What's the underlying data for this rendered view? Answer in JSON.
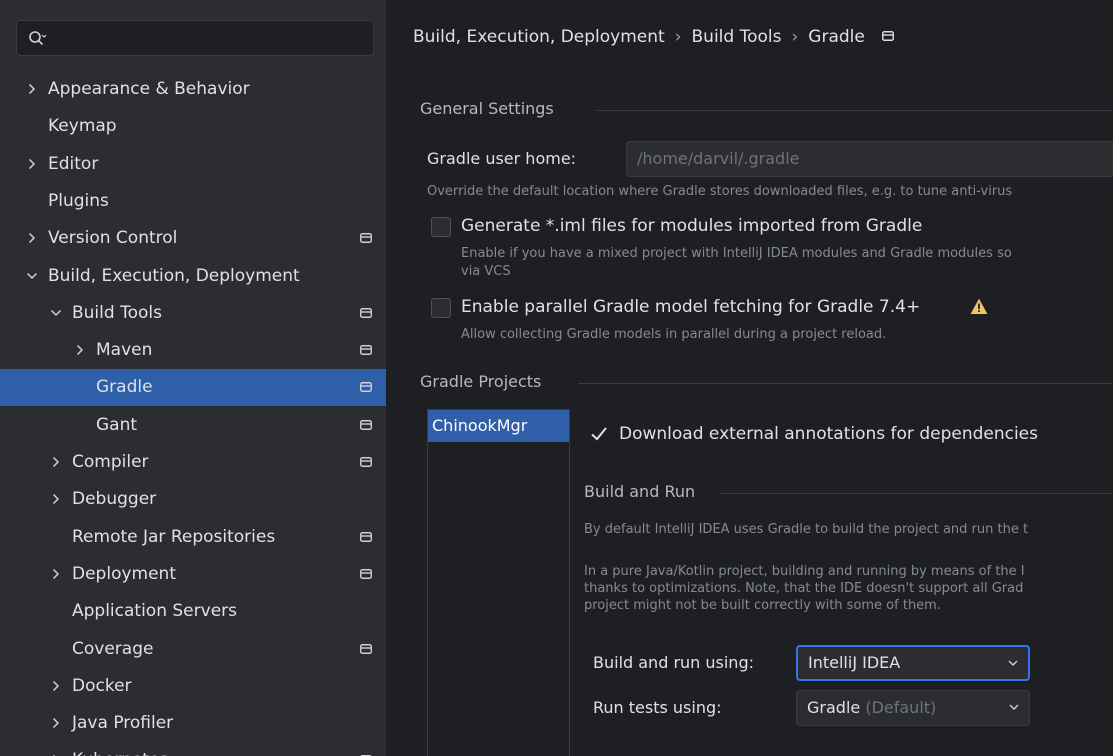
{
  "sidebar": {
    "search": {
      "value": ""
    },
    "items": [
      {
        "label": "Appearance & Behavior",
        "expandable": true,
        "expanded": false,
        "depth": 0,
        "project": false
      },
      {
        "label": "Keymap",
        "expandable": false,
        "depth": 0,
        "project": false
      },
      {
        "label": "Editor",
        "expandable": true,
        "expanded": false,
        "depth": 0,
        "project": false
      },
      {
        "label": "Plugins",
        "expandable": false,
        "depth": 0,
        "project": false
      },
      {
        "label": "Version Control",
        "expandable": true,
        "expanded": false,
        "depth": 0,
        "project": true
      },
      {
        "label": "Build, Execution, Deployment",
        "expandable": true,
        "expanded": true,
        "depth": 0,
        "project": false
      },
      {
        "label": "Build Tools",
        "expandable": true,
        "expanded": true,
        "depth": 1,
        "project": true
      },
      {
        "label": "Maven",
        "expandable": true,
        "expanded": false,
        "depth": 2,
        "project": true
      },
      {
        "label": "Gradle",
        "expandable": false,
        "depth": 2,
        "project": true,
        "selected": true
      },
      {
        "label": "Gant",
        "expandable": false,
        "depth": 2,
        "project": true
      },
      {
        "label": "Compiler",
        "expandable": true,
        "expanded": false,
        "depth": 1,
        "project": true
      },
      {
        "label": "Debugger",
        "expandable": true,
        "expanded": false,
        "depth": 1,
        "project": false
      },
      {
        "label": "Remote Jar Repositories",
        "expandable": false,
        "depth": 1,
        "project": true
      },
      {
        "label": "Deployment",
        "expandable": true,
        "expanded": false,
        "depth": 1,
        "project": true
      },
      {
        "label": "Application Servers",
        "expandable": false,
        "depth": 1,
        "project": false
      },
      {
        "label": "Coverage",
        "expandable": false,
        "depth": 1,
        "project": true
      },
      {
        "label": "Docker",
        "expandable": true,
        "expanded": false,
        "depth": 1,
        "project": false
      },
      {
        "label": "Java Profiler",
        "expandable": true,
        "expanded": false,
        "depth": 1,
        "project": false
      },
      {
        "label": "Kubernetes",
        "expandable": true,
        "expanded": false,
        "depth": 1,
        "project": true
      }
    ]
  },
  "breadcrumb": {
    "items": [
      "Build, Execution, Deployment",
      "Build Tools",
      "Gradle"
    ]
  },
  "general_settings": {
    "title": "General Settings",
    "user_home_label": "Gradle user home:",
    "user_home_value": "/home/darvil/.gradle",
    "user_home_hint": "Override the default location where Gradle stores downloaded files, e.g. to tune anti-virus",
    "iml": {
      "label": "Generate *.iml files for modules imported from Gradle",
      "checked": false,
      "hint1": "Enable if you have a mixed project with IntelliJ IDEA modules and Gradle modules so",
      "hint2": "via VCS"
    },
    "parallel": {
      "label": "Enable parallel Gradle model fetching for Gradle 7.4+",
      "checked": false,
      "hint": "Allow collecting Gradle models in parallel during a project reload."
    }
  },
  "gradle_projects": {
    "title": "Gradle Projects",
    "projects": [
      "ChinookMgr"
    ],
    "download_annotations": {
      "label": "Download external annotations for dependencies",
      "checked": true
    },
    "build_and_run": {
      "title": "Build and Run",
      "desc1": "By default IntelliJ IDEA uses Gradle to build the project and run the t",
      "desc2": "In a pure Java/Kotlin project, building and running by means of the I",
      "desc3": "thanks to optimizations. Note, that the IDE doesn't support all Grad",
      "desc4": "project might not be built correctly with some of them.",
      "build_run_label": "Build and run using:",
      "build_run_value": "IntelliJ IDEA",
      "run_tests_label": "Run tests using:",
      "run_tests_value": "Gradle",
      "run_tests_suffix": "(Default)"
    }
  },
  "colors": {
    "selection": "#2e5fa8",
    "focus_border": "#3574f0",
    "warning": "#f2c55c"
  }
}
